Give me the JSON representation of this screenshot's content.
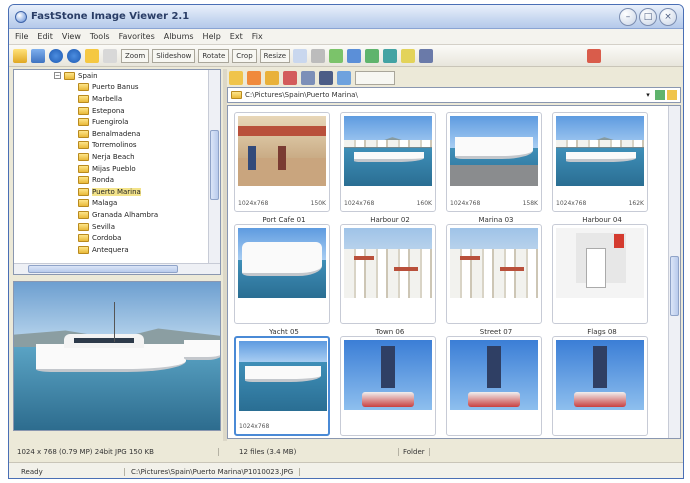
{
  "window": {
    "title": "FastStone Image Viewer 2.1"
  },
  "menu": [
    "File",
    "Edit",
    "View",
    "Tools",
    "Favorites",
    "Albums",
    "Help",
    "Ext",
    "Fix"
  ],
  "toolbar": {
    "buttons": [
      "Zoom",
      "Slideshow",
      "Rotate",
      "Crop",
      "Resize"
    ],
    "search_placeholder": ""
  },
  "tree": {
    "root": "Spain",
    "items": [
      "Puerto Banus",
      "Marbella",
      "Estepona",
      "Fuengirola",
      "Benalmadena",
      "Torremolinos",
      "Nerja Beach",
      "Mijas Pueblo",
      "Ronda",
      "Puerto Marina",
      "Malaga",
      "Granada Alhambra",
      "Sevilla",
      "Cordoba",
      "Antequera"
    ],
    "selected_index": 9
  },
  "address": {
    "path": "C:\\Pictures\\Spain\\Puerto Marina\\"
  },
  "thumbnails": [
    {
      "name": "Port Cafe 01",
      "meta_left": "1024x768",
      "meta_right": "150K",
      "scene": "cafe"
    },
    {
      "name": "Harbour 02",
      "meta_left": "1024x768",
      "meta_right": "160K",
      "scene": "harbour"
    },
    {
      "name": "Marina 03",
      "meta_left": "1024x768",
      "meta_right": "158K",
      "scene": "marina"
    },
    {
      "name": "Harbour 04",
      "meta_left": "1024x768",
      "meta_right": "162K",
      "scene": "harbour"
    },
    {
      "name": "Yacht 05",
      "meta_left": "",
      "meta_right": "",
      "scene": "yacht"
    },
    {
      "name": "Town 06",
      "meta_left": "",
      "meta_right": "",
      "scene": "town"
    },
    {
      "name": "Street 07",
      "meta_left": "",
      "meta_right": "",
      "scene": "town"
    },
    {
      "name": "Flags 08",
      "meta_left": "",
      "meta_right": "",
      "scene": "flags"
    },
    {
      "name": "",
      "meta_left": "1024x768",
      "meta_right": "",
      "scene": "boat"
    },
    {
      "name": "",
      "meta_left": "",
      "meta_right": "",
      "scene": "fountain"
    },
    {
      "name": "",
      "meta_left": "",
      "meta_right": "",
      "scene": "fountain"
    },
    {
      "name": "",
      "meta_left": "",
      "meta_right": "",
      "scene": "fountain"
    }
  ],
  "status": {
    "left": "1024 x 768 (0.79 MP) 24bit JPG 150 KB",
    "middle": "12 files (3.4 MB)",
    "right": "Folder",
    "bottom_left": "Ready",
    "bottom_path": "C:\\Pictures\\Spain\\Puerto Marina\\P1010023.JPG"
  },
  "colors": {
    "titlebar": "#c8d8f0",
    "selection": "#4a8ad6",
    "tree_highlight": "#f3e38a"
  }
}
